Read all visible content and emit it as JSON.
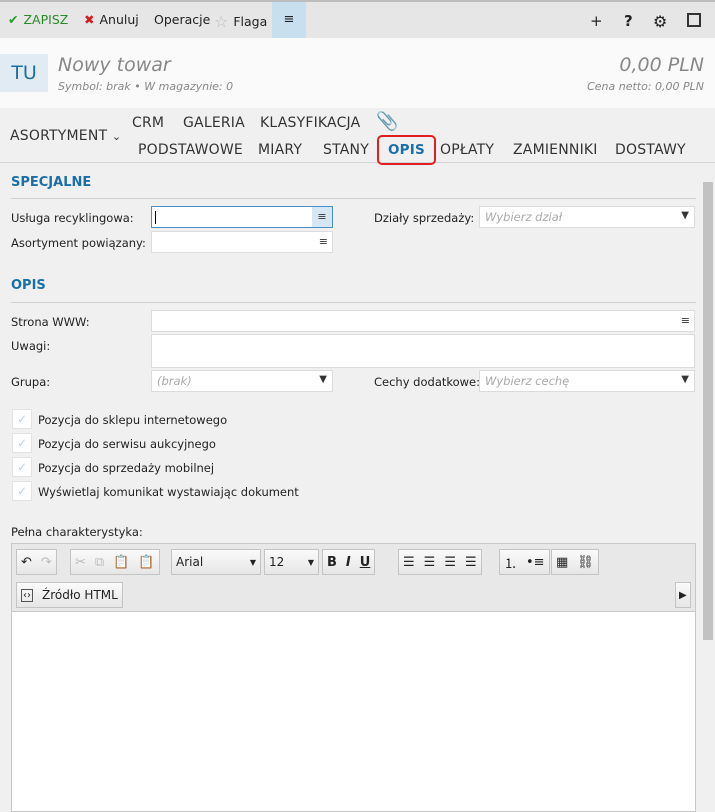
{
  "toolbar": {
    "save": "ZAPISZ",
    "cancel": "Anuluj",
    "operations": "Operacje",
    "flag": "Flaga"
  },
  "header": {
    "avatar": "TU",
    "title": "Nowy towar",
    "symbol": "Symbol: brak",
    "stock": "W magazynie: 0",
    "price": "0,00 PLN",
    "net_price": "Cena netto: 0,00 PLN"
  },
  "tabs": {
    "group": "ASORTYMENT",
    "row1": [
      "CRM",
      "GALERIA",
      "KLASYFIKACJA"
    ],
    "row2": [
      "PODSTAWOWE",
      "MIARY",
      "STANY",
      "OPIS",
      "OPŁATY",
      "ZAMIENNIKI",
      "DOSTAWY"
    ],
    "active": "OPIS"
  },
  "special": {
    "title": "SPECJALNE",
    "recycling_label": "Usługa recyklingowa:",
    "recycling_value": "",
    "sales_dept_label": "Działy sprzedaży:",
    "sales_dept_placeholder": "Wybierz dział",
    "related_label": "Asortyment powiązany:",
    "related_value": ""
  },
  "desc": {
    "title": "OPIS",
    "www_label": "Strona WWW:",
    "www_value": "",
    "notes_label": "Uwagi:",
    "notes_value": "",
    "group_label": "Grupa:",
    "group_placeholder": "(brak)",
    "features_label": "Cechy dodatkowe:",
    "features_placeholder": "Wybierz cechę",
    "checkboxes": [
      "Pozycja do sklepu internetowego",
      "Pozycja do serwisu aukcyjnego",
      "Pozycja do sprzedaży mobilnej",
      "Wyświetlaj komunikat wystawiając dokument"
    ],
    "full_label": "Pełna charakterystyka:"
  },
  "editor": {
    "font": "Arial",
    "size": "12",
    "source": "Źródło HTML"
  }
}
